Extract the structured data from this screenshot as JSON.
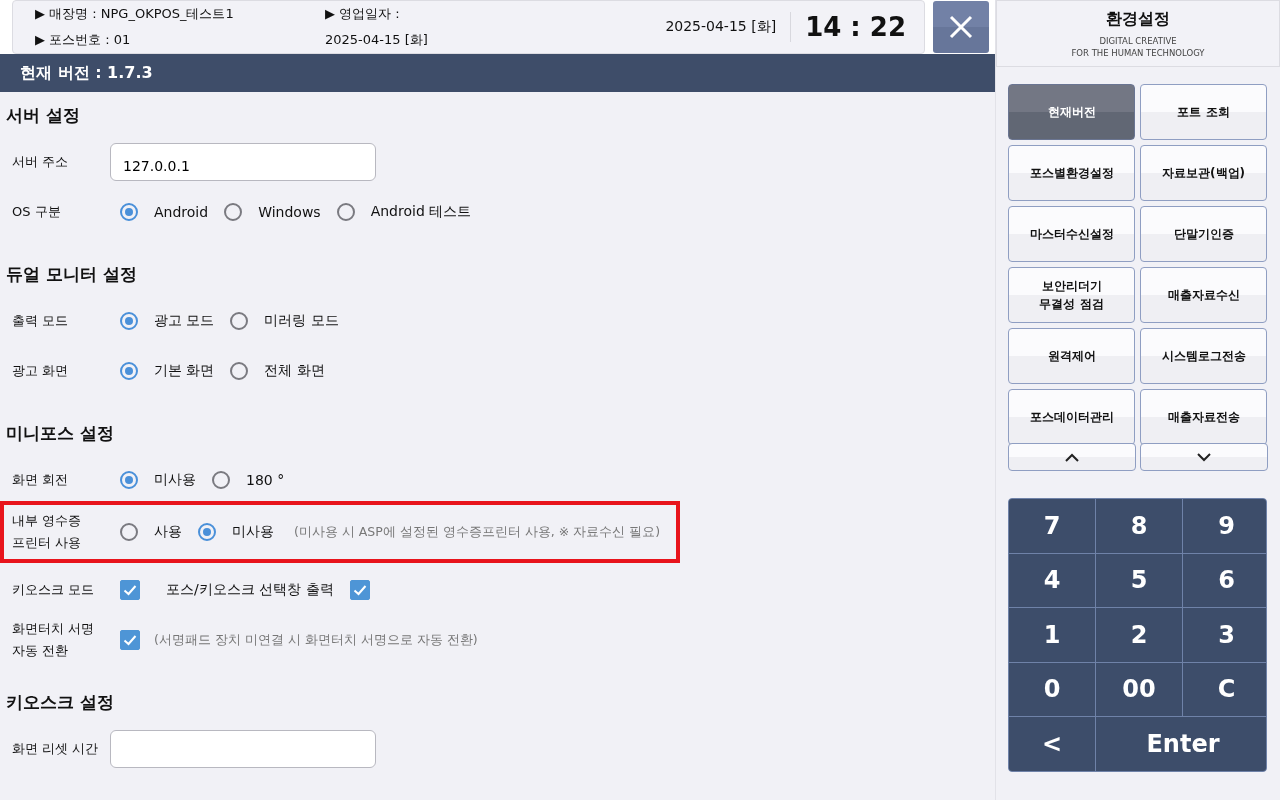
{
  "header": {
    "info": [
      {
        "text": "▶ 매장명 : NPG_OKPOS_테스트1"
      },
      {
        "text": "▶ 영업일자 :"
      },
      {
        "text": "▶ 포스번호 : 01"
      },
      {
        "text": "2025-04-15 [화]"
      }
    ],
    "date": "2025-04-15 [화]",
    "time": "14 : 22"
  },
  "version_bar": "현재 버전 : 1.7.3",
  "sections": [
    {
      "title": "서버 설정",
      "rows": [
        {
          "kind": "input",
          "label": "서버 주소",
          "value": "127.0.0.1"
        },
        {
          "kind": "radio",
          "label": "OS 구분",
          "options": [
            {
              "label": "Android",
              "selected": true
            },
            {
              "label": "Windows",
              "selected": false
            },
            {
              "label": "Android 테스트",
              "selected": false
            }
          ]
        }
      ]
    },
    {
      "title": "듀얼 모니터 설정",
      "rows": [
        {
          "kind": "radio",
          "label": "출력 모드",
          "options": [
            {
              "label": "광고 모드",
              "selected": true
            },
            {
              "label": "미러링 모드",
              "selected": false
            }
          ]
        },
        {
          "kind": "radio",
          "label": "광고 화면",
          "options": [
            {
              "label": "기본 화면",
              "selected": true
            },
            {
              "label": "전체 화면",
              "selected": false
            }
          ]
        }
      ]
    },
    {
      "title": "미니포스 설정",
      "rows": [
        {
          "kind": "radio",
          "label": "화면 회전",
          "options": [
            {
              "label": "미사용",
              "selected": true
            },
            {
              "label": "180 °",
              "selected": false
            }
          ]
        },
        {
          "kind": "radio",
          "label": "내부 영수증 프린터 사용",
          "highlighted": true,
          "options": [
            {
              "label": "사용",
              "selected": false
            },
            {
              "label": "미사용",
              "selected": true
            }
          ],
          "note": "(미사용 시 ASP에 설정된 영수증프린터 사용, ※ 자료수신 필요)"
        },
        {
          "kind": "checkbox",
          "label": "키오스크 모드",
          "checked": true,
          "extra": [
            {
              "label": "포스/키오스크 선택창 출력",
              "checked": true
            }
          ]
        },
        {
          "kind": "checkbox",
          "label": "화면터치 서명 자동 전환",
          "checked": true,
          "note": "(서명패드 장치 미연결 시 화면터치 서명으로 자동 전환)"
        }
      ]
    },
    {
      "title": "키오스크 설정",
      "rows": [
        {
          "kind": "input",
          "label": "화면 리셋 시간"
        }
      ]
    }
  ],
  "side_panel": {
    "title": "환경설정",
    "subtitle": [
      "DIGITAL CREATIVE",
      "FOR THE HUMAN TECHNOLOGY"
    ],
    "menu": [
      {
        "label": "현재버전",
        "selected": true
      },
      {
        "label": "포트 조회",
        "selected": false
      },
      {
        "label": "포스별환경설정",
        "selected": false
      },
      {
        "label": "자료보관(백업)",
        "selected": false
      },
      {
        "label": "마스터수신설정",
        "selected": false
      },
      {
        "label": "단말기인증",
        "selected": false
      },
      {
        "label": "보안리더기 무결성 점검",
        "selected": false
      },
      {
        "label": "매출자료수신",
        "selected": false
      },
      {
        "label": "원격제어",
        "selected": false
      },
      {
        "label": "시스템로그전송",
        "selected": false
      },
      {
        "label": "포스데이터관리",
        "selected": false
      },
      {
        "label": "매출자료전송",
        "selected": false
      }
    ],
    "keypad": [
      {
        "label": "7"
      },
      {
        "label": "8"
      },
      {
        "label": "9"
      },
      {
        "label": "4"
      },
      {
        "label": "5"
      },
      {
        "label": "6"
      },
      {
        "label": "1"
      },
      {
        "label": "2"
      },
      {
        "label": "3"
      },
      {
        "label": "0"
      },
      {
        "label": "00"
      },
      {
        "label": "C"
      },
      {
        "label": "<"
      },
      {
        "label": "Enter",
        "wide": true
      }
    ]
  }
}
